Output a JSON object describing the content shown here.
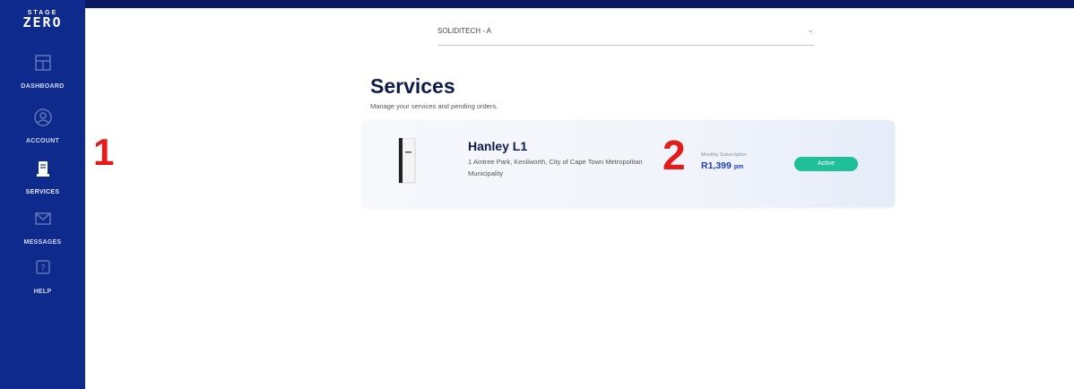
{
  "brand": {
    "small": "STAGE",
    "big": "ZERO"
  },
  "sidebar": {
    "items": [
      {
        "label": "DASHBOARD",
        "icon": "dashboard-icon"
      },
      {
        "label": "ACCOUNT",
        "icon": "account-icon"
      },
      {
        "label": "SERVICES",
        "icon": "services-icon",
        "active": true
      },
      {
        "label": "MESSAGES",
        "icon": "messages-icon"
      },
      {
        "label": "HELP",
        "icon": "help-icon"
      }
    ]
  },
  "account_select": {
    "value": "SOLIDITECH - A"
  },
  "page": {
    "title": "Services",
    "subtitle": "Manage your services and pending orders."
  },
  "service_card": {
    "name": "Hanley L1",
    "address": "1 Aintree Park, Kenilworth, City of Cape Town Metropolitan Municipality",
    "subscription_label": "Monthly Subscription",
    "price": "R1,399",
    "price_unit": "pm",
    "status": "Active"
  },
  "annotations": {
    "one": "1",
    "two": "2"
  },
  "colors": {
    "sidebar": "#0d2a8c",
    "title": "#0f1a4d",
    "price": "#1c3fb2",
    "status": "#1fbf9a",
    "annotation": "#e31b1b"
  }
}
